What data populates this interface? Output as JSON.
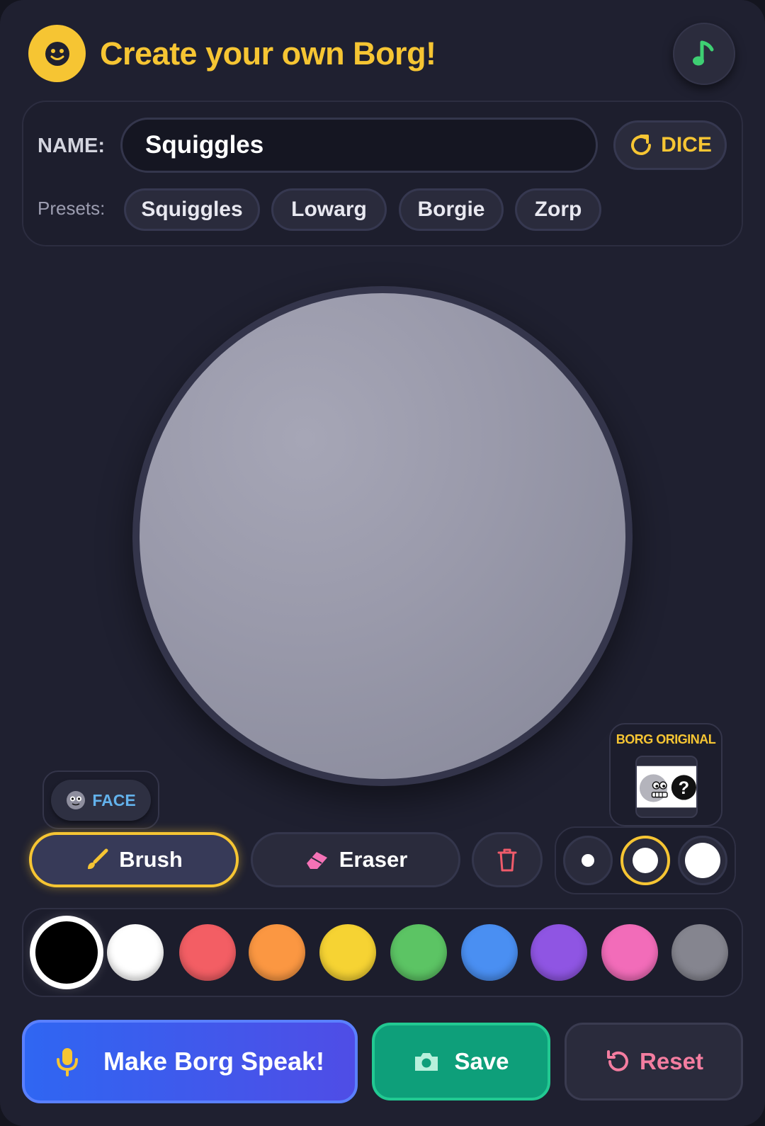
{
  "header": {
    "title": "Create your own Borg!",
    "logo_icon": "smiley-icon",
    "music_icon": "music-note-icon"
  },
  "name_panel": {
    "name_label": "NAME:",
    "name_value": "Squiggles",
    "dice_label": "DICE",
    "presets_label": "Presets:",
    "presets": [
      "Squiggles",
      "Lowarg",
      "Borgie",
      "Zorp"
    ]
  },
  "face_button": {
    "label": "FACE"
  },
  "borg_original": {
    "label": "BORG ORIGINAL"
  },
  "tools": {
    "brush_label": "Brush",
    "eraser_label": "Eraser",
    "selected_tool": "Brush",
    "brush_sizes": [
      "small",
      "medium",
      "large"
    ],
    "selected_size": "medium"
  },
  "palette": {
    "colors": [
      "#000000",
      "#ffffff",
      "#f35e64",
      "#fb9742",
      "#f6d333",
      "#5cc464",
      "#4a8ff2",
      "#8f55e3",
      "#f26cb9",
      "#85858f"
    ],
    "selected": "#000000"
  },
  "actions": {
    "speak_label": "Make Borg Speak!",
    "save_label": "Save",
    "reset_label": "Reset"
  },
  "theme": {
    "background": "#1f2030",
    "accent": "#f6c533",
    "speak": "#2f66f2",
    "save": "#0e9f7a",
    "reset_text": "#f47da0"
  }
}
